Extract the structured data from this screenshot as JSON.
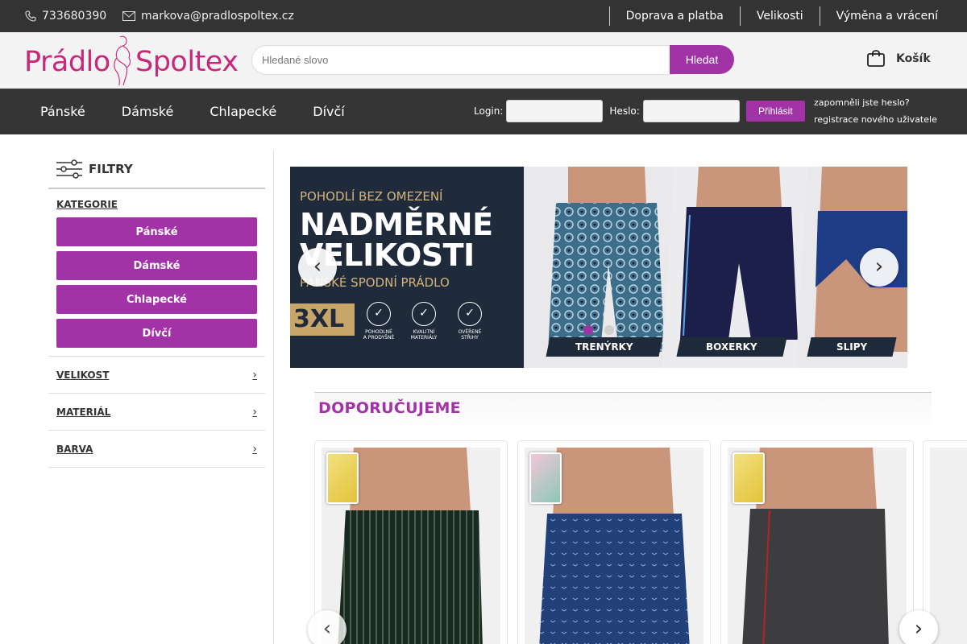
{
  "topbar": {
    "phone": "733680390",
    "email": "markova@pradlospoltex.cz",
    "links": [
      "Doprava a platba",
      "Velikosti",
      "Výměna a vrácení"
    ]
  },
  "header": {
    "logo_part1": "Prádlo",
    "logo_part2": "Spoltex",
    "search_placeholder": "Hledané slovo",
    "search_button": "Hledat",
    "cart_label": "Košík"
  },
  "nav": {
    "items": [
      "Pánské",
      "Dámské",
      "Chlapecké",
      "Dívčí"
    ],
    "login_label": "Login:",
    "password_label": "Heslo:",
    "login_button": "Přihlásit",
    "forgot_password": "zapomněli jste heslo?",
    "register": "registrace nového uživatele"
  },
  "sidebar": {
    "title": "FILTRY",
    "category_label": "KATEGORIE",
    "categories": [
      "Pánské",
      "Dámské",
      "Chlapecké",
      "Dívčí"
    ],
    "facets": [
      "VELIKOST",
      "MATERIÁL",
      "BARVA"
    ]
  },
  "banner": {
    "kicker": "POHODLÍ BEZ OMEZENÍ",
    "headline_line1": "NADMĚRNÉ",
    "headline_line2": "VELIKOSTI",
    "subline": "PÁNSKÉ SPODNÍ PRÁDLO",
    "size_badge": "3XL",
    "features": [
      {
        "line1": "POHODLNÉ",
        "line2": "A PRODYŠNÉ"
      },
      {
        "line1": "KVALITNÍ",
        "line2": "MATERIÁLY"
      },
      {
        "line1": "OVĚŘENÉ",
        "line2": "STŘIHY"
      }
    ],
    "panels": [
      "TRENÝRKY",
      "BOXERKY",
      "SLIPY"
    ],
    "prev_arrow": "‹",
    "next_arrow": "›",
    "active_slide": 1,
    "slide_count": 2
  },
  "recommended": {
    "title": "DOPORUČUJEME",
    "prev_arrow": "‹",
    "next_arrow": "›"
  },
  "colors": {
    "accent": "#a233a6",
    "logo": "#c8287a",
    "topbar": "#333333",
    "navbar": "#353535",
    "banner_dark": "#1f2b3b"
  }
}
